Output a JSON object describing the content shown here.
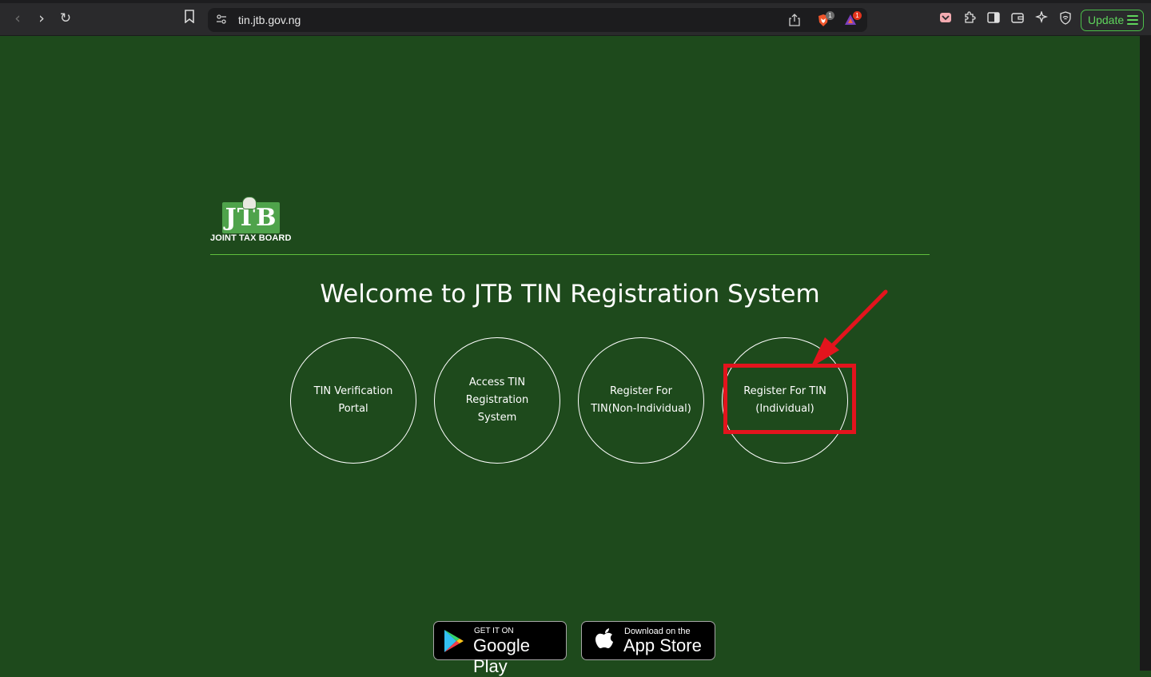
{
  "browser": {
    "url": "tin.jtb.gov.ng",
    "update_label": "Update",
    "brave_badge": "1",
    "rewards_badge": "1"
  },
  "page": {
    "logo_text": "JTB",
    "logo_caption": "JOINT TAX BOARD",
    "heading": "Welcome to JTB TIN Registration System",
    "options": [
      {
        "label": "TIN Verification\nPortal"
      },
      {
        "label": "Access TIN\nRegistration System"
      },
      {
        "label": "Register For\nTIN(Non-Individual)"
      },
      {
        "label": "Register For TIN\n(Individual)"
      }
    ],
    "google_play": {
      "small": "GET IT ON",
      "big": "Google Play"
    },
    "app_store": {
      "small": "Download on the",
      "big": "App Store"
    }
  },
  "colors": {
    "page_bg": "#1e4a1c",
    "logo_green": "#4fa34b",
    "highlight_red": "#e3141d",
    "divider_green": "#5fbf3d"
  }
}
